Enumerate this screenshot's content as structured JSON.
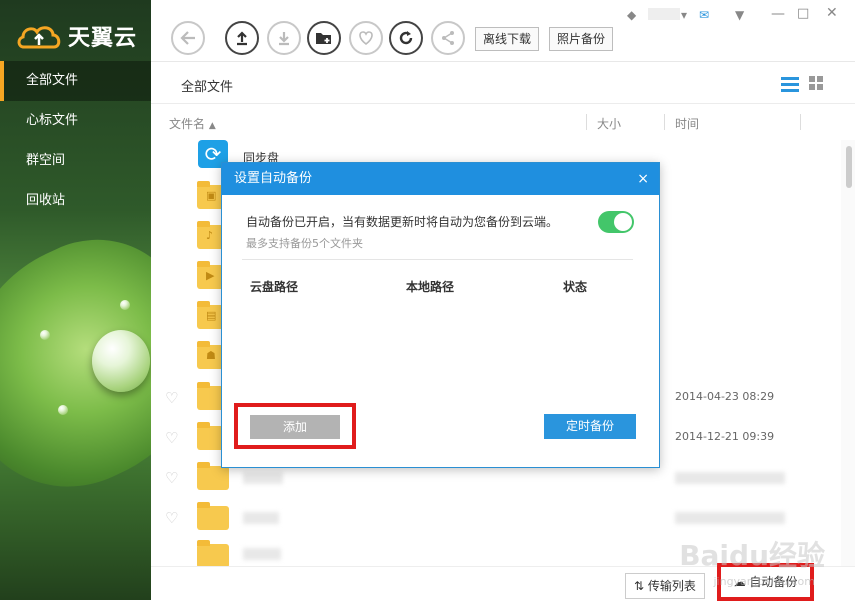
{
  "app": {
    "logo_text": "天翼云"
  },
  "sidebar": {
    "items": [
      {
        "label": "全部文件",
        "active": true
      },
      {
        "label": "心标文件"
      },
      {
        "label": "群空间"
      },
      {
        "label": "回收站"
      }
    ]
  },
  "toolbar": {
    "icons": [
      "back-icon",
      "upload-icon",
      "download-icon",
      "new-folder-icon",
      "favorite-icon",
      "refresh-icon",
      "share-icon"
    ],
    "offline_download": "离线下载",
    "photo_backup": "照片备份"
  },
  "breadcrumb": "全部文件",
  "columns": {
    "name": "文件名",
    "size": "大小",
    "time": "时间"
  },
  "files": [
    {
      "name": "同步盘",
      "time": ""
    },
    {
      "name": "",
      "time": ""
    },
    {
      "name": "",
      "time": ""
    },
    {
      "name": "",
      "time": ""
    },
    {
      "name": "",
      "time": ""
    },
    {
      "name": "",
      "time": ""
    },
    {
      "name": "",
      "time": "2014-04-23 08:29"
    },
    {
      "name": "",
      "time": "2014-12-21 09:39"
    }
  ],
  "bottom": {
    "transfer_list": "传输列表",
    "auto_backup": "自动备份"
  },
  "dialog": {
    "title": "设置自动备份",
    "close": "×",
    "description": "自动备份已开启，当有数据更新时将自动为您备份到云端。",
    "note": "最多支持备份5个文件夹",
    "toggle_on": true,
    "headers": {
      "cloud_path": "云盘路径",
      "local_path": "本地路径",
      "status": "状态"
    },
    "add_button": "添加",
    "timer_button": "定时备份"
  },
  "watermark": {
    "main": "Baidu经验",
    "sub": "jingyan.baidu.com"
  },
  "colors": {
    "accent": "#1f8fdf",
    "highlight": "#e01c1c",
    "toggle": "#43c66a",
    "sidebar_active": "#f5a623"
  }
}
